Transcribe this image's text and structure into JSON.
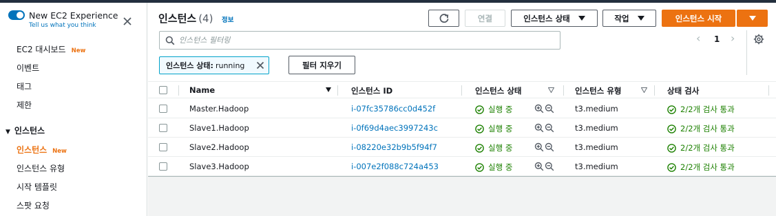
{
  "sidebar": {
    "experience_title": "New EC2 Experience",
    "experience_link": "Tell us what you think",
    "items": [
      {
        "label": "EC2 대시보드",
        "badge": "New"
      },
      {
        "label": "이벤트"
      },
      {
        "label": "태그"
      },
      {
        "label": "제한"
      }
    ],
    "section_title": "인스턴스",
    "section_items": [
      {
        "label": "인스턴스",
        "badge": "New",
        "active": true
      },
      {
        "label": "인스턴스 유형"
      },
      {
        "label": "시작 템플릿"
      },
      {
        "label": "스팟 요청"
      }
    ]
  },
  "header": {
    "title": "인스턴스",
    "count": "(4)",
    "info": "정보",
    "refresh_icon": "refresh-icon",
    "connect_label": "연결",
    "instance_state_label": "인스턴스 상태",
    "actions_label": "작업",
    "launch_label": "인스턴스 시작"
  },
  "search": {
    "placeholder": "인스턴스 필터링",
    "value": ""
  },
  "pagination": {
    "prev": "‹",
    "page": "1",
    "next": "›"
  },
  "filter": {
    "token_key": "인스턴스 상태:",
    "token_value": "running",
    "clear_label": "필터 지우기"
  },
  "table": {
    "columns": [
      "Name",
      "인스턴스 ID",
      "인스턴스 상태",
      "인스턴스 유형",
      "상태 검사"
    ],
    "rows": [
      {
        "name": "Master.Hadoop",
        "id": "i-07fc35786cc0d452f",
        "state": "실행 중",
        "type": "t3.medium",
        "check": "2/2개 검사 통과"
      },
      {
        "name": "Slave1.Hadoop",
        "id": "i-0f69d4aec3997243c",
        "state": "실행 중",
        "type": "t3.medium",
        "check": "2/2개 검사 통과"
      },
      {
        "name": "Slave2.Hadoop",
        "id": "i-08220e32b9b5f94f7",
        "state": "실행 중",
        "type": "t3.medium",
        "check": "2/2개 검사 통과"
      },
      {
        "name": "Slave3.Hadoop",
        "id": "i-007e2f088c724a453",
        "state": "실행 중",
        "type": "t3.medium",
        "check": "2/2개 검사 통과"
      }
    ]
  },
  "colors": {
    "accent": "#ec7211",
    "link": "#0073bb",
    "success": "#1d8102",
    "navbar": "#232f3e"
  }
}
